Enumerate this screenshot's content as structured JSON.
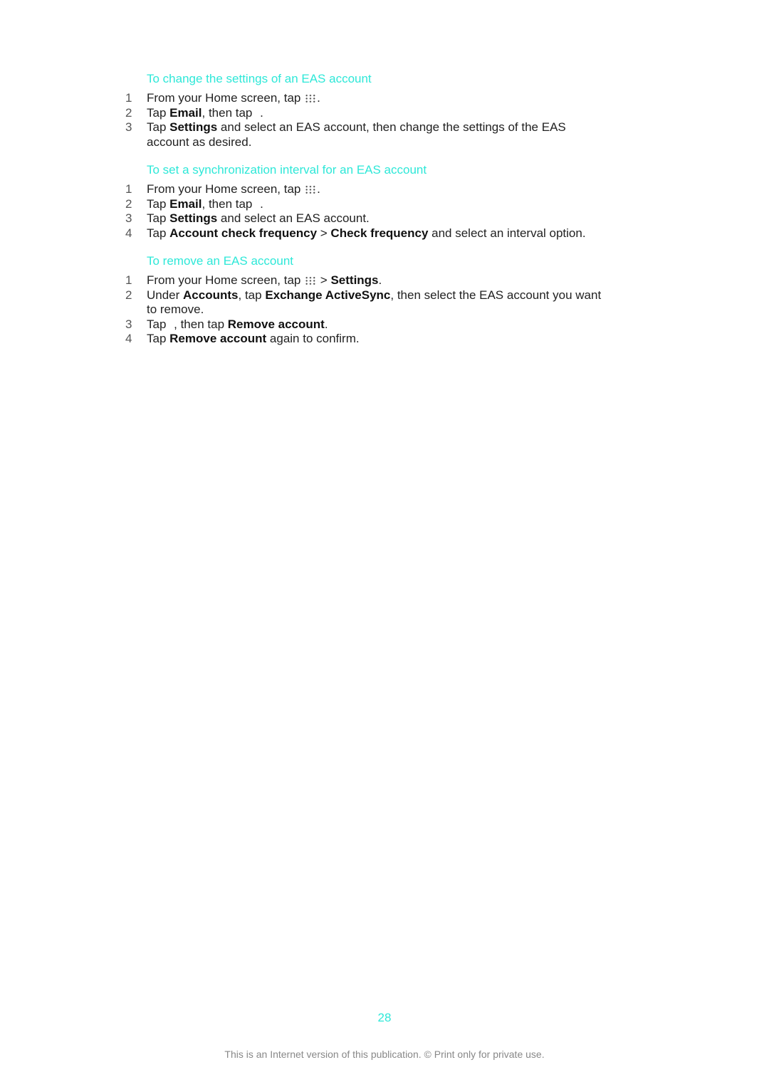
{
  "sections": [
    {
      "heading": "To change the settings of an EAS account",
      "steps": [
        {
          "n": "1",
          "a": "From your Home screen, tap ",
          "b": "."
        },
        {
          "n": "2",
          "a": "Tap ",
          "bold1": "Email",
          "b": ", then tap ",
          "c": "."
        },
        {
          "n": "3",
          "a": "Tap ",
          "bold1": "Settings",
          "b": " and select an EAS account, then change the settings of the EAS account as desired."
        }
      ]
    },
    {
      "heading": "To set a synchronization interval for an EAS account",
      "steps": [
        {
          "n": "1",
          "a": "From your Home screen, tap ",
          "b": "."
        },
        {
          "n": "2",
          "a": "Tap ",
          "bold1": "Email",
          "b": ", then tap ",
          "c": "."
        },
        {
          "n": "3",
          "a": "Tap ",
          "bold1": "Settings",
          "b": " and select an EAS account."
        },
        {
          "n": "4",
          "a": "Tap ",
          "bold1": "Account check frequency",
          "b": " > ",
          "bold2": "Check frequency",
          "c": " and select an interval option."
        }
      ]
    },
    {
      "heading": "To remove an EAS account",
      "steps": [
        {
          "n": "1",
          "a": "From your Home screen, tap ",
          "b": " > ",
          "bold1": "Settings",
          "c": "."
        },
        {
          "n": "2",
          "a": "Under ",
          "bold1": "Accounts",
          "b": ", tap ",
          "bold2": "Exchange ActiveSync",
          "c": ", then select the EAS account you want to remove."
        },
        {
          "n": "3",
          "a": "Tap ",
          "b": ", then tap ",
          "bold1": "Remove account",
          "c": "."
        },
        {
          "n": "4",
          "a": "Tap ",
          "bold1": "Remove account",
          "b": " again to confirm."
        }
      ]
    }
  ],
  "page_number": "28",
  "footer": "This is an Internet version of this publication. © Print only for private use.",
  "colors": {
    "heading": "#2ee8d8",
    "page_number": "#2ee8d8"
  }
}
